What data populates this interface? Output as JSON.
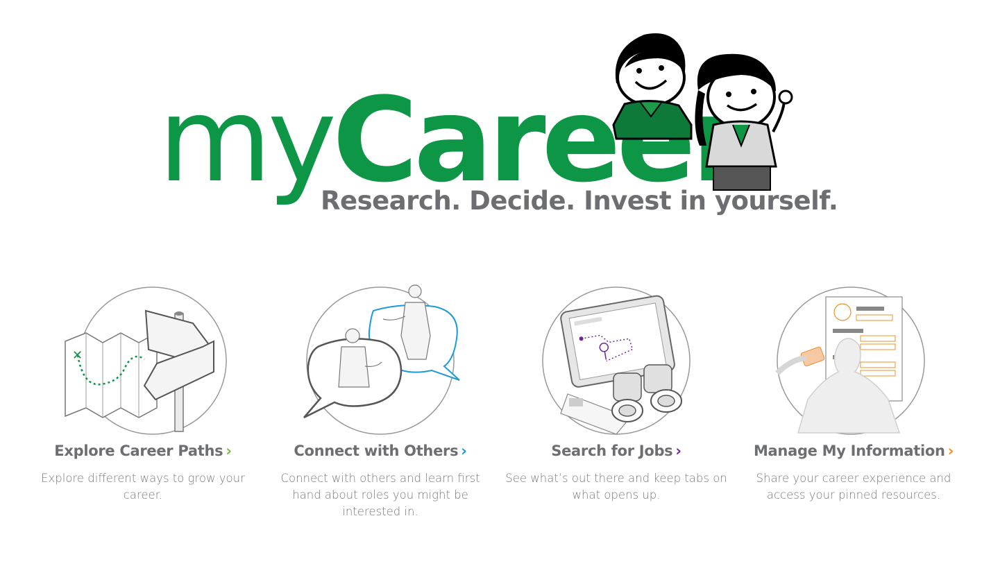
{
  "brand": {
    "logo_my": "my",
    "logo_career": "Career",
    "tagline": "Research. Decide. Invest in yourself."
  },
  "colors": {
    "brand_green": "#0e9647",
    "text_gray": "#6d6e71",
    "desc_gray": "#7a7a7a",
    "chevron_green": "#7ab648",
    "chevron_blue": "#1a9ad6",
    "chevron_purple": "#6b2c91",
    "chevron_orange": "#f0902a"
  },
  "tiles": [
    {
      "title": "Explore Career Paths",
      "chevron": "›",
      "description": "Explore different ways to grow your career.",
      "icon": "map-signpost-icon"
    },
    {
      "title": "Connect with Others",
      "chevron": "›",
      "description": "Connect with others and learn first hand about roles you might be interested in.",
      "icon": "conversation-bubbles-icon"
    },
    {
      "title": "Search for Jobs",
      "chevron": "›",
      "description": "See what’s out there and keep tabs on what opens up.",
      "icon": "tablet-binoculars-icon"
    },
    {
      "title": "Manage My Information",
      "chevron": "›",
      "description": "Share your career experience and access your pinned resources.",
      "icon": "profile-document-icon"
    }
  ]
}
